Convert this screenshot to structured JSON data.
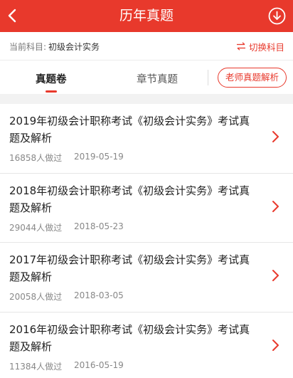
{
  "header": {
    "title": "历年真题",
    "back_icon": "chevron-left-icon",
    "download_icon": "download-circle-icon",
    "brand_color": "#e8392c"
  },
  "subject": {
    "label": "当前科目:",
    "value": "初级会计实务",
    "switch_label": "切换科目",
    "switch_icon": "swap-arrows-icon"
  },
  "tabs": [
    {
      "label": "真题卷",
      "active": true
    },
    {
      "label": "章节真题",
      "active": false
    }
  ],
  "teacher_button": "老师真题解析",
  "papers": [
    {
      "title": "2019年初级会计职称考试《初级会计实务》考试真题及解析",
      "count": "16858人做过",
      "date": "2019-05-19"
    },
    {
      "title": "2018年初级会计职称考试《初级会计实务》考试真题及解析",
      "count": "29044人做过",
      "date": "2018-05-23"
    },
    {
      "title": "2017年初级会计职称考试《初级会计实务》考试真题及解析",
      "count": "20058人做过",
      "date": "2018-03-05"
    },
    {
      "title": "2016年初级会计职称考试《初级会计实务》考试真题及解析",
      "count": "11384人做过",
      "date": "2016-05-19"
    }
  ]
}
